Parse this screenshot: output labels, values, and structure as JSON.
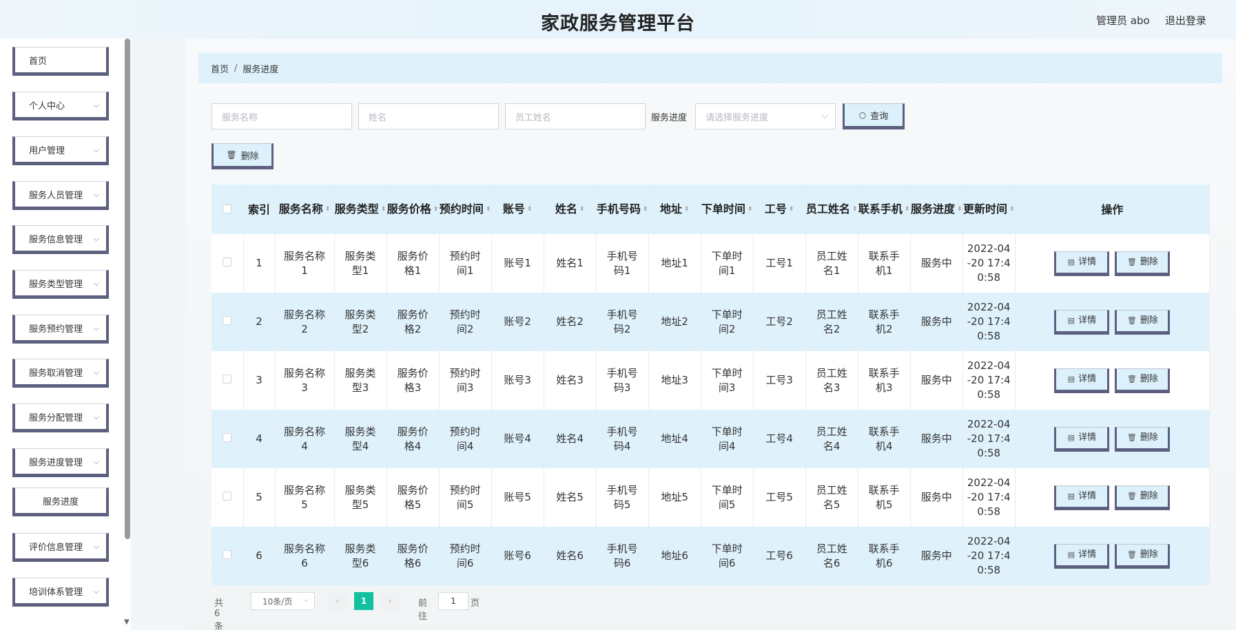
{
  "header": {
    "title": "家政服务管理平台",
    "user": "管理员 abo",
    "logout": "退出登录"
  },
  "sidebar": {
    "items": [
      {
        "label": "首页",
        "has_children": false
      },
      {
        "label": "个人中心",
        "has_children": true
      },
      {
        "label": "用户管理",
        "has_children": true
      },
      {
        "label": "服务人员管理",
        "has_children": true
      },
      {
        "label": "服务信息管理",
        "has_children": true
      },
      {
        "label": "服务类型管理",
        "has_children": true
      },
      {
        "label": "服务预约管理",
        "has_children": true
      },
      {
        "label": "服务取消管理",
        "has_children": true
      },
      {
        "label": "服务分配管理",
        "has_children": true
      },
      {
        "label": "服务进度管理",
        "has_children": true
      },
      {
        "label": "服务进度",
        "has_children": false
      },
      {
        "label": "评价信息管理",
        "has_children": true
      },
      {
        "label": "培训体系管理",
        "has_children": true
      }
    ]
  },
  "breadcrumb": {
    "home": "首页",
    "separator": "/",
    "current": "服务进度"
  },
  "filters": {
    "service_name_placeholder": "服务名称",
    "name_placeholder": "姓名",
    "staff_name_placeholder": "员工姓名",
    "progress_label": "服务进度",
    "progress_placeholder": "请选择服务进度",
    "search_label": "查询"
  },
  "toolbar": {
    "delete_label": "删除"
  },
  "table": {
    "columns": [
      "索引",
      "服务名称",
      "服务类型",
      "服务价格",
      "预约时间",
      "账号",
      "姓名",
      "手机号码",
      "地址",
      "下单时间",
      "工号",
      "员工姓名",
      "联系手机",
      "服务进度",
      "更新时间",
      "操作"
    ],
    "rows": [
      {
        "index": "1",
        "service_name": "服务名称1",
        "service_type": "服务类型1",
        "price": "服务价格1",
        "appointment": "预约时间1",
        "account": "账号1",
        "name": "姓名1",
        "phone": "手机号码1",
        "address": "地址1",
        "order_time": "下单时间1",
        "staff_no": "工号1",
        "staff_name": "员工姓名1",
        "contact": "联系手机1",
        "progress": "服务中",
        "updated": "2022-04-20 17:40:58"
      },
      {
        "index": "2",
        "service_name": "服务名称2",
        "service_type": "服务类型2",
        "price": "服务价格2",
        "appointment": "预约时间2",
        "account": "账号2",
        "name": "姓名2",
        "phone": "手机号码2",
        "address": "地址2",
        "order_time": "下单时间2",
        "staff_no": "工号2",
        "staff_name": "员工姓名2",
        "contact": "联系手机2",
        "progress": "服务中",
        "updated": "2022-04-20 17:40:58"
      },
      {
        "index": "3",
        "service_name": "服务名称3",
        "service_type": "服务类型3",
        "price": "服务价格3",
        "appointment": "预约时间3",
        "account": "账号3",
        "name": "姓名3",
        "phone": "手机号码3",
        "address": "地址3",
        "order_time": "下单时间3",
        "staff_no": "工号3",
        "staff_name": "员工姓名3",
        "contact": "联系手机3",
        "progress": "服务中",
        "updated": "2022-04-20 17:40:58"
      },
      {
        "index": "4",
        "service_name": "服务名称4",
        "service_type": "服务类型4",
        "price": "服务价格4",
        "appointment": "预约时间4",
        "account": "账号4",
        "name": "姓名4",
        "phone": "手机号码4",
        "address": "地址4",
        "order_time": "下单时间4",
        "staff_no": "工号4",
        "staff_name": "员工姓名4",
        "contact": "联系手机4",
        "progress": "服务中",
        "updated": "2022-04-20 17:40:58"
      },
      {
        "index": "5",
        "service_name": "服务名称5",
        "service_type": "服务类型5",
        "price": "服务价格5",
        "appointment": "预约时间5",
        "account": "账号5",
        "name": "姓名5",
        "phone": "手机号码5",
        "address": "地址5",
        "order_time": "下单时间5",
        "staff_no": "工号5",
        "staff_name": "员工姓名5",
        "contact": "联系手机5",
        "progress": "服务中",
        "updated": "2022-04-20 17:40:58"
      },
      {
        "index": "6",
        "service_name": "服务名称6",
        "service_type": "服务类型6",
        "price": "服务价格6",
        "appointment": "预约时间6",
        "account": "账号6",
        "name": "姓名6",
        "phone": "手机号码6",
        "address": "地址6",
        "order_time": "下单时间6",
        "staff_no": "工号6",
        "staff_name": "员工姓名6",
        "contact": "联系手机6",
        "progress": "服务中",
        "updated": "2022-04-20 17:40:58"
      }
    ],
    "detail_label": "详情",
    "delete_label": "删除"
  },
  "pagination": {
    "total": "共 6 条",
    "page_size": "10条/页",
    "current_page": "1",
    "goto_label": "前往",
    "goto_value": "1",
    "page_suffix": "页"
  },
  "colors": {
    "accent": "#13c0a0",
    "header_row": "#dff2fc",
    "button_border": "#5d5f7f"
  },
  "icons": {
    "search": "search-icon",
    "delete": "trash-icon",
    "detail": "document-icon",
    "chevron": "chevron-down-icon",
    "sort": "sort-icon"
  }
}
